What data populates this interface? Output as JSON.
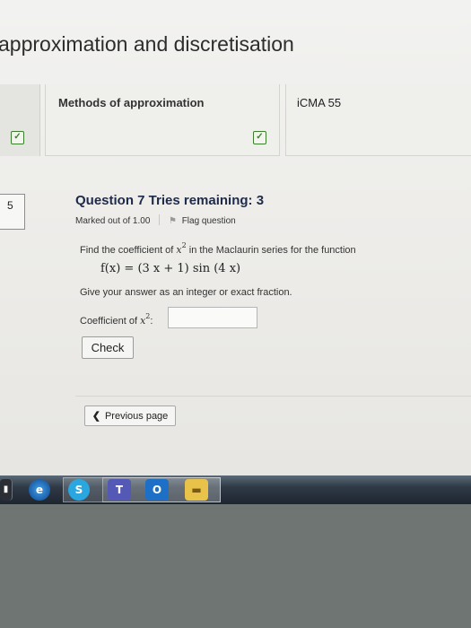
{
  "page": {
    "heading": "approximation and discretisation"
  },
  "tabs": [
    {
      "label": "Methods of approximation"
    },
    {
      "label": "iCMA 55"
    }
  ],
  "question": {
    "number": "5",
    "title": "Question 7 Tries remaining: 3",
    "marked_out_of": "Marked out of 1.00",
    "flag_label": "Flag question",
    "prompt_before": "Find the coefficient of ",
    "prompt_var": "x",
    "prompt_power": "2",
    "prompt_after": " in the Maclaurin series for the function",
    "formula": "f(x) = (3 x + 1) sin (4 x)",
    "instruction": "Give your answer as an integer or exact fraction.",
    "answer_label_text": "Coefficient of ",
    "answer_var": "x",
    "answer_power": "2",
    "answer_colon": ":",
    "answer_value": "",
    "answer_placeholder": ""
  },
  "buttons": {
    "check": "Check",
    "previous_page": "Previous page",
    "previous_chevron": "❮"
  },
  "taskbar": {
    "items": [
      {
        "name": "start",
        "glyph": "▮"
      },
      {
        "name": "internet-explorer",
        "glyph": "e"
      },
      {
        "name": "skype",
        "glyph": "S"
      },
      {
        "name": "teams",
        "glyph": "T"
      },
      {
        "name": "outlook",
        "glyph": "O"
      },
      {
        "name": "file-explorer",
        "glyph": "▬"
      }
    ]
  },
  "colors": {
    "accent_icon": "#3b7f2e",
    "question_title": "#1e2a4a"
  }
}
